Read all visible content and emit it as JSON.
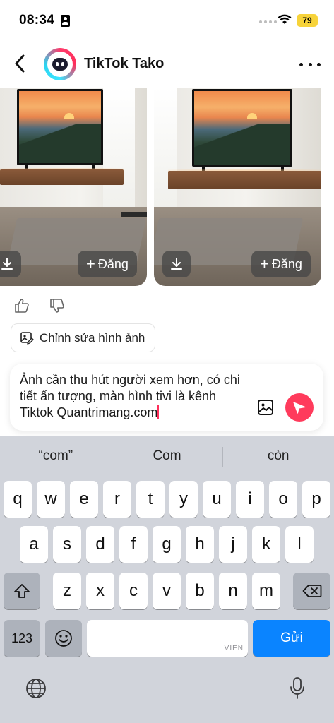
{
  "status_bar": {
    "time": "08:34",
    "battery": "79",
    "battery_color": "#f7d33a"
  },
  "header": {
    "title": "TikTok Tako",
    "back_icon": "chevron-left-icon",
    "more_icon": "more-horizontal-icon"
  },
  "image_cards": [
    {
      "post_label": "Đăng",
      "download_icon": "download-icon"
    },
    {
      "post_label": "Đăng",
      "download_icon": "download-icon"
    }
  ],
  "feedback": {
    "like_icon": "thumbs-up-icon",
    "dislike_icon": "thumbs-down-icon"
  },
  "edit_chip": {
    "label": "Chỉnh sửa hình ảnh",
    "icon": "image-edit-icon"
  },
  "composer": {
    "text": "Ảnh cần thu hút người xem hơn, có chi tiết ấn tượng, màn hình tivi là kênh Tiktok Quantrimang.com",
    "send_color": "#ff3b5c"
  },
  "keyboard": {
    "suggestions": [
      "“com”",
      "Com",
      "còn"
    ],
    "row1": [
      "q",
      "w",
      "e",
      "r",
      "t",
      "y",
      "u",
      "i",
      "o",
      "p"
    ],
    "row2": [
      "a",
      "s",
      "d",
      "f",
      "g",
      "h",
      "j",
      "k",
      "l"
    ],
    "row3": [
      "z",
      "x",
      "c",
      "v",
      "b",
      "n",
      "m"
    ],
    "numbers_label": "123",
    "space_hint": "VIEN",
    "return_label": "Gửi",
    "return_color": "#0a84ff"
  }
}
